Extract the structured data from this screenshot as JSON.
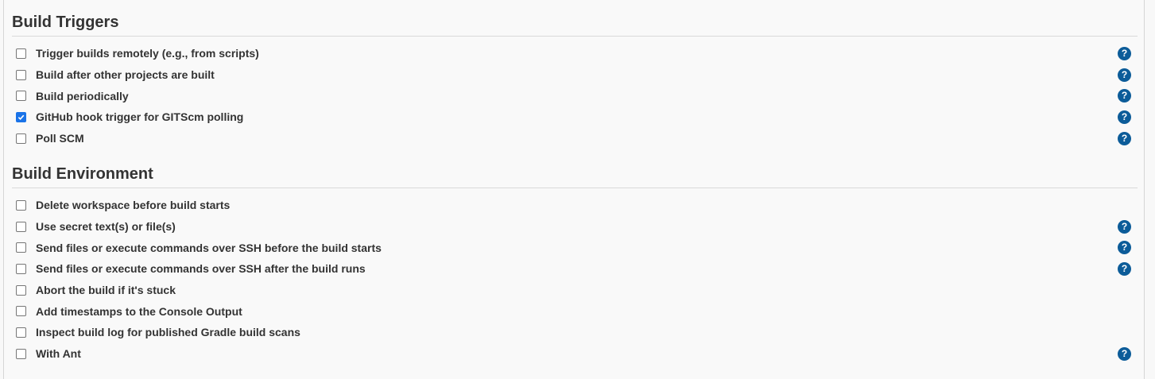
{
  "build_triggers": {
    "title": "Build Triggers",
    "items": [
      {
        "label": "Trigger builds remotely (e.g., from scripts)",
        "checked": false,
        "help": true
      },
      {
        "label": "Build after other projects are built",
        "checked": false,
        "help": true
      },
      {
        "label": "Build periodically",
        "checked": false,
        "help": true
      },
      {
        "label": "GitHub hook trigger for GITScm polling",
        "checked": true,
        "help": true
      },
      {
        "label": "Poll SCM",
        "checked": false,
        "help": true
      }
    ]
  },
  "build_environment": {
    "title": "Build Environment",
    "items": [
      {
        "label": "Delete workspace before build starts",
        "checked": false,
        "help": false
      },
      {
        "label": "Use secret text(s) or file(s)",
        "checked": false,
        "help": true
      },
      {
        "label": "Send files or execute commands over SSH before the build starts",
        "checked": false,
        "help": true
      },
      {
        "label": "Send files or execute commands over SSH after the build runs",
        "checked": false,
        "help": true
      },
      {
        "label": "Abort the build if it's stuck",
        "checked": false,
        "help": false
      },
      {
        "label": "Add timestamps to the Console Output",
        "checked": false,
        "help": false
      },
      {
        "label": "Inspect build log for published Gradle build scans",
        "checked": false,
        "help": false
      },
      {
        "label": "With Ant",
        "checked": false,
        "help": true
      }
    ]
  },
  "help_icon_glyph": "?",
  "colors": {
    "checkbox_checked": "#1a73e8",
    "help_icon": "#0c5c99"
  }
}
